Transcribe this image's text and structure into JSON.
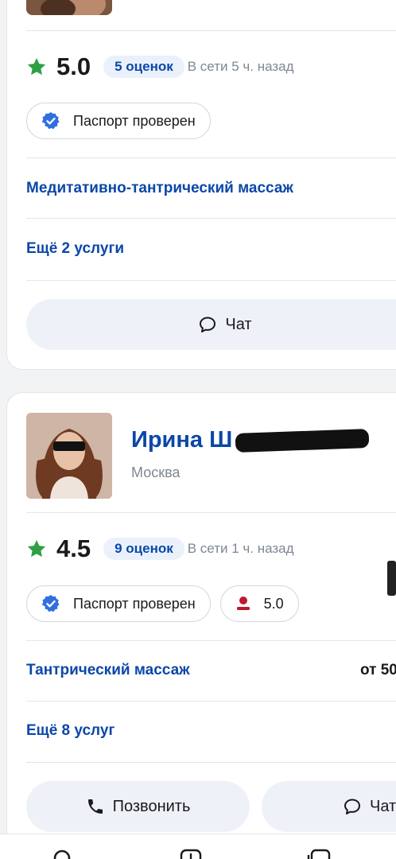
{
  "card1": {
    "rating": "5.0",
    "reviews": "5 оценок",
    "online": "В сети 5 ч. назад",
    "badge_passport": "Паспорт проверен",
    "service": "Медитативно-тантрический массаж",
    "more_services": "Ещё 2 услуги",
    "chat_label": "Чат"
  },
  "card2": {
    "name": "Ирина Ш",
    "city": "Москва",
    "rating": "4.5",
    "reviews": "9 оценок",
    "online": "В сети 1 ч. назад",
    "badge_passport": "Паспорт проверен",
    "badge_score": "5.0",
    "service": "Тантрический массаж",
    "service_price": "от 50",
    "more_services": "Ещё 8 услуг",
    "call_label": "Позвонить",
    "chat_label": "Чат"
  },
  "colors": {
    "link": "#0b47a8",
    "star": "#2ea043",
    "verified": "#2f6fe0",
    "score_icon": "#c0172f"
  },
  "icons": [
    "star-icon",
    "verified-check-icon",
    "chat-bubble-icon",
    "phone-icon",
    "person-icon",
    "search-icon",
    "add-icon",
    "copy-icon"
  ]
}
